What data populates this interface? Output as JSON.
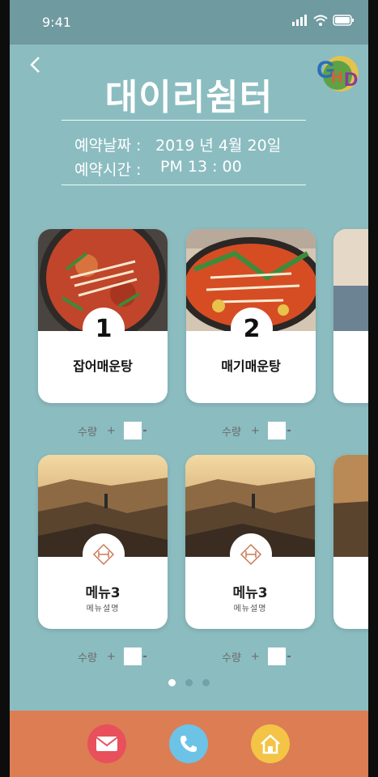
{
  "status": {
    "time": "9:41"
  },
  "header": {
    "title": "대이리쉼터"
  },
  "reservation": {
    "date_label": "예약날짜 :",
    "date_value": "2019 년 4월 20일",
    "time_label": "예약시간 :",
    "time_value": "PM 13 : 00"
  },
  "menu_row1": [
    {
      "number": "1",
      "name": "잡어매운탕"
    },
    {
      "number": "2",
      "name": "매기매운탕"
    }
  ],
  "menu_row2": [
    {
      "name": "메뉴3",
      "desc": "메뉴설명"
    },
    {
      "name": "메뉴3",
      "desc": "메뉴설명"
    }
  ],
  "quantity": {
    "label": "수량",
    "plus": "+"
  },
  "pager": {
    "count": 3,
    "active": 0
  },
  "footer": {
    "icons": [
      "mail-icon",
      "phone-icon",
      "home-icon"
    ]
  },
  "colors": {
    "background": "#8bbcc0",
    "footer": "#dc7d54",
    "mail": "#e8505b",
    "phone": "#6cc3e6",
    "home": "#f3c445"
  }
}
